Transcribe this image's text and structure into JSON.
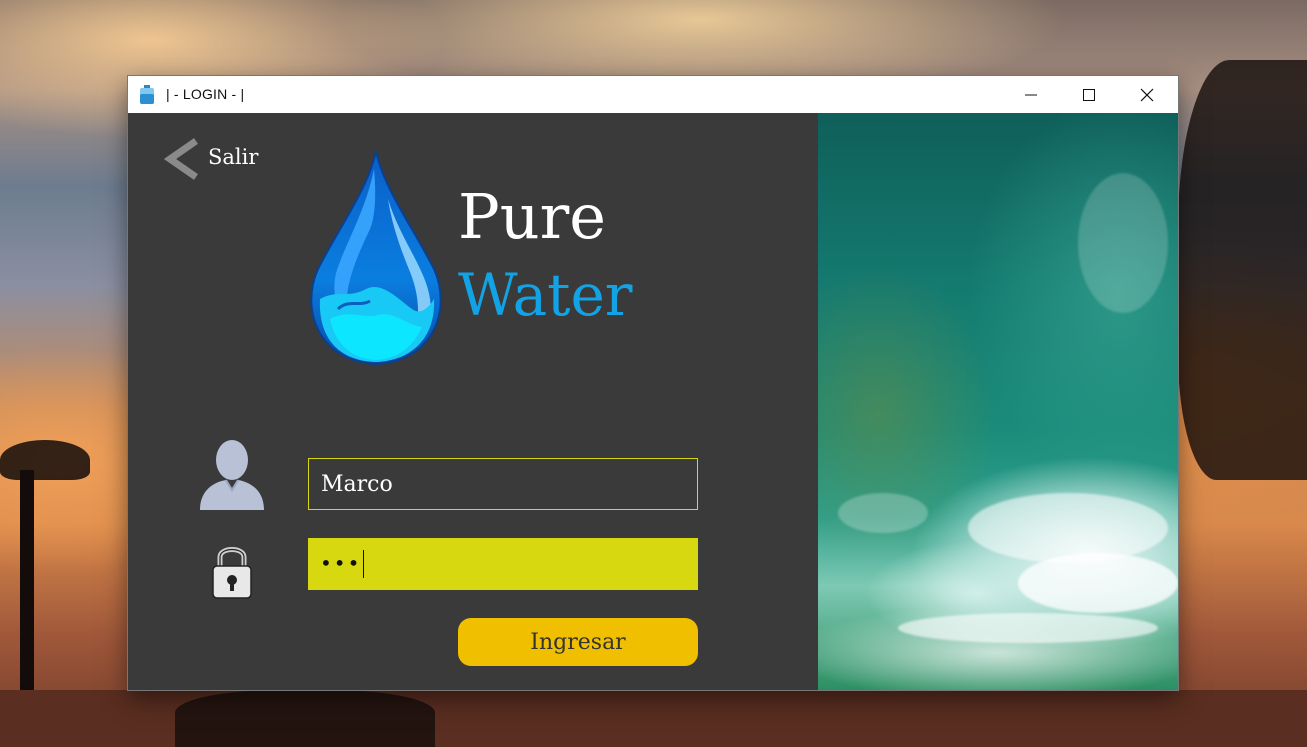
{
  "window": {
    "title": "| - LOGIN - |",
    "controls": [
      "minimize",
      "maximize",
      "close"
    ]
  },
  "exit": {
    "label": "Salir"
  },
  "brand": {
    "line1": "Pure",
    "line2": "Water",
    "accent_color": "#12a3e6"
  },
  "form": {
    "username_value": "Marco",
    "password_mask": "•••",
    "submit_label": "Ingresar",
    "field_accent_color": "#d7d80f",
    "button_color": "#f0c000"
  },
  "icons": [
    "app-water-bottle-icon",
    "back-chevron-icon",
    "water-drop-logo",
    "user-icon",
    "lock-icon"
  ]
}
